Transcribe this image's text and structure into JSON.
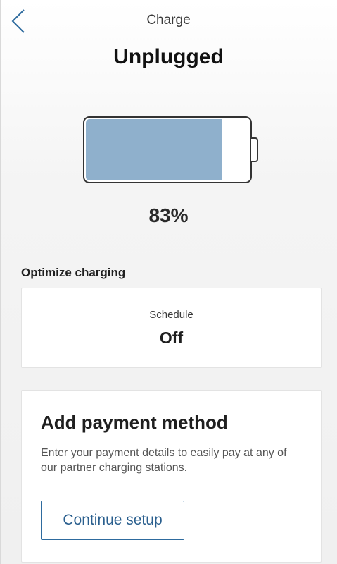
{
  "header": {
    "title": "Charge",
    "back_icon": "chevron-left-icon"
  },
  "status": {
    "title": "Unplugged"
  },
  "battery": {
    "level_percent": 83,
    "percent_label": "83%",
    "fill_color": "#8fb0cc"
  },
  "optimize": {
    "heading": "Optimize charging",
    "schedule_label": "Schedule",
    "schedule_value": "Off"
  },
  "payment": {
    "title": "Add payment method",
    "description": "Enter your payment details to easily pay at any of our partner charging stations.",
    "button_label": "Continue setup",
    "accent_color": "#2e6b9e"
  }
}
